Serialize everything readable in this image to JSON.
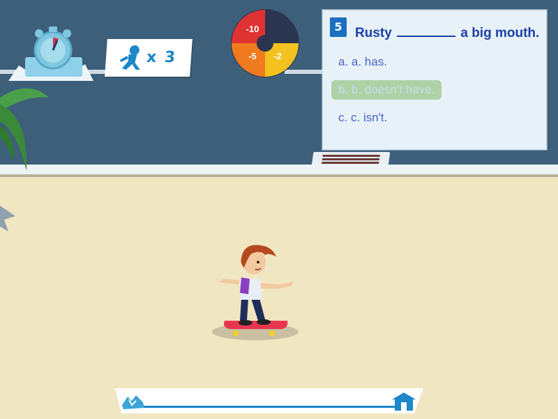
{
  "hud": {
    "lives_label": "x 3",
    "lives_count": 3,
    "timer": {
      "icon": "stopwatch-icon",
      "level": 0.1
    },
    "penalty_wheel": {
      "segments": [
        "-10",
        "-5",
        "-2"
      ],
      "colors": [
        "#e03232",
        "#f07a1e",
        "#f3c21e",
        "#2c3550"
      ]
    }
  },
  "question": {
    "number": "5",
    "text_before": "Rusty",
    "text_after": "a big mouth.",
    "options": [
      {
        "label": "a. a. has.",
        "selected": false
      },
      {
        "label": "b. b. doesn't have.",
        "selected": true
      },
      {
        "label": "c. c. isn't.",
        "selected": false
      }
    ]
  },
  "progress": {
    "value": 0,
    "start_icon": "broken-ground-icon",
    "end_icon": "house-icon"
  },
  "colors": {
    "accent": "#1d87c8",
    "question_text": "#1d3fa6",
    "option_text": "#4a62c8",
    "selected_bg": "#aed2a6",
    "sky": "#3d5f7a",
    "sand": "#f1e6c2"
  }
}
